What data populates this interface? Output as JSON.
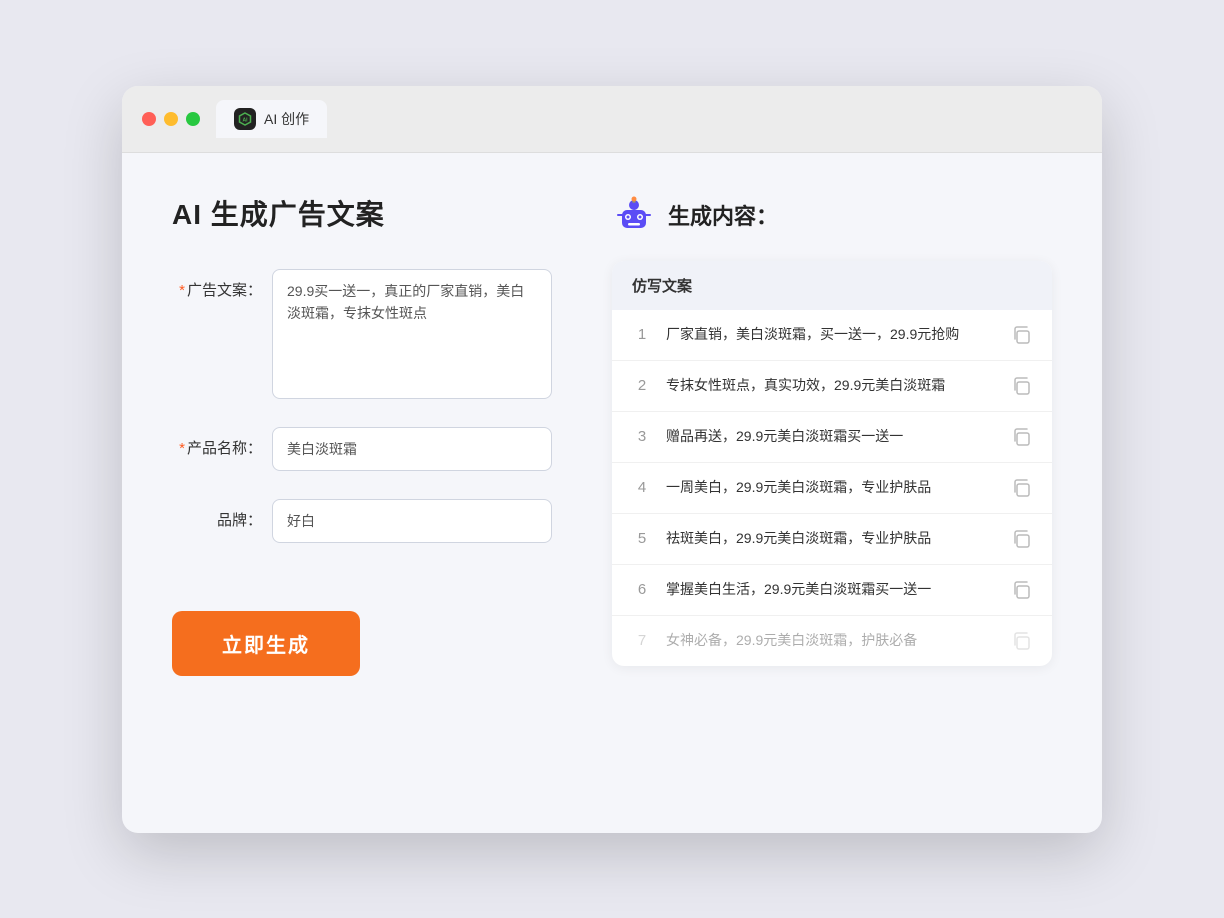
{
  "window": {
    "tab_label": "AI 创作",
    "tab_icon": "AI"
  },
  "left": {
    "title": "AI 生成广告文案",
    "fields": [
      {
        "id": "ad_copy",
        "label": "广告文案：",
        "required": true,
        "type": "textarea",
        "value": "29.9买一送一，真正的厂家直销，美白淡斑霜，专抹女性斑点"
      },
      {
        "id": "product_name",
        "label": "产品名称：",
        "required": true,
        "type": "input",
        "value": "美白淡斑霜"
      },
      {
        "id": "brand",
        "label": "品牌：",
        "required": false,
        "type": "input",
        "value": "好白"
      }
    ],
    "button_label": "立即生成"
  },
  "right": {
    "title": "生成内容：",
    "table_header": "仿写文案",
    "results": [
      {
        "num": "1",
        "text": "厂家直销，美白淡斑霜，买一送一，29.9元抢购",
        "dimmed": false
      },
      {
        "num": "2",
        "text": "专抹女性斑点，真实功效，29.9元美白淡斑霜",
        "dimmed": false
      },
      {
        "num": "3",
        "text": "赠品再送，29.9元美白淡斑霜买一送一",
        "dimmed": false
      },
      {
        "num": "4",
        "text": "一周美白，29.9元美白淡斑霜，专业护肤品",
        "dimmed": false
      },
      {
        "num": "5",
        "text": "祛斑美白，29.9元美白淡斑霜，专业护肤品",
        "dimmed": false
      },
      {
        "num": "6",
        "text": "掌握美白生活，29.9元美白淡斑霜买一送一",
        "dimmed": false
      },
      {
        "num": "7",
        "text": "女神必备，29.9元美白淡斑霜，护肤必备",
        "dimmed": true
      }
    ]
  }
}
